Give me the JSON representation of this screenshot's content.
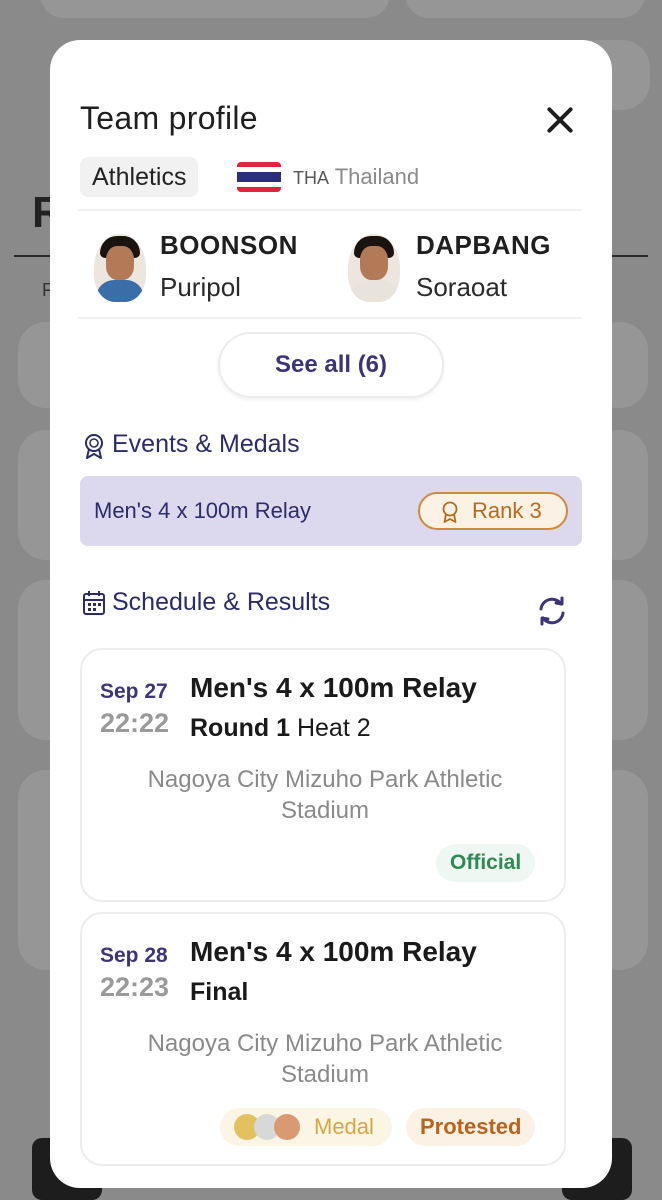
{
  "modal": {
    "title": "Team profile",
    "sport": "Athletics",
    "country_code": "THA",
    "country_name": "Thailand"
  },
  "athletes": [
    {
      "last": "BOONSON",
      "first": "Puripol"
    },
    {
      "last": "DAPBANG",
      "first": "Soraoat"
    }
  ],
  "see_all_label": "See all (6)",
  "events_medals": {
    "title": "Events & Medals",
    "event_name": "Men's 4 x 100m Relay",
    "rank_label": "Rank 3"
  },
  "schedule": {
    "title": "Schedule & Results",
    "items": [
      {
        "date": "Sep 27",
        "time": "22:22",
        "event": "Men's 4 x 100m Relay",
        "round": "Round 1",
        "heat": "Heat 2",
        "venue": "Nagoya City Mizuho Park Athletic Stadium",
        "status": "Official"
      },
      {
        "date": "Sep 28",
        "time": "22:23",
        "event": "Men's 4 x 100m Relay",
        "round": "Final",
        "heat": "",
        "venue": "Nagoya City Mizuho Park Athletic Stadium",
        "medal_label": "Medal",
        "status": "Protested"
      }
    ]
  },
  "colors": {
    "accent": "#3d3578",
    "official": "#2f8a55",
    "protested": "#b8651d",
    "medal_gold": "#e3c15e",
    "medal_silver": "#d8d8d8",
    "medal_bronze": "#d99a72"
  }
}
